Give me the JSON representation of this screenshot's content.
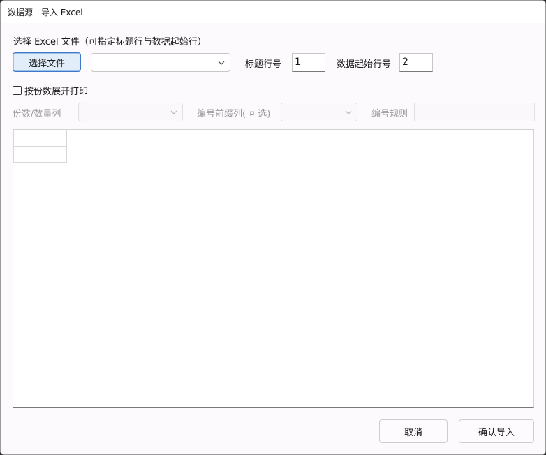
{
  "window": {
    "title": "数据源 - 导入 Excel"
  },
  "file_section": {
    "label": "选择 Excel 文件（可指定标题行与数据起始行）",
    "choose_button": "选择文件",
    "sheet_select_value": "",
    "header_row_label": "标题行号",
    "header_row_value": "1",
    "data_start_label": "数据起始行号",
    "data_start_value": "2"
  },
  "print_options": {
    "expand_by_copies_label": "按份数展开打印",
    "expand_by_copies_checked": false,
    "copies_column_label": "份数/数量列",
    "copies_column_value": "",
    "prefix_column_label": "编号前缀列( 可选)",
    "prefix_column_value": "",
    "numbering_rule_label": "编号规则",
    "numbering_rule_value": ""
  },
  "footer": {
    "cancel_button": "取消",
    "confirm_button": "确认导入"
  },
  "colors": {
    "accent_border": "#3e79c9",
    "accent_fill": "#e1edf9",
    "window_bg": "#fdfafd"
  }
}
